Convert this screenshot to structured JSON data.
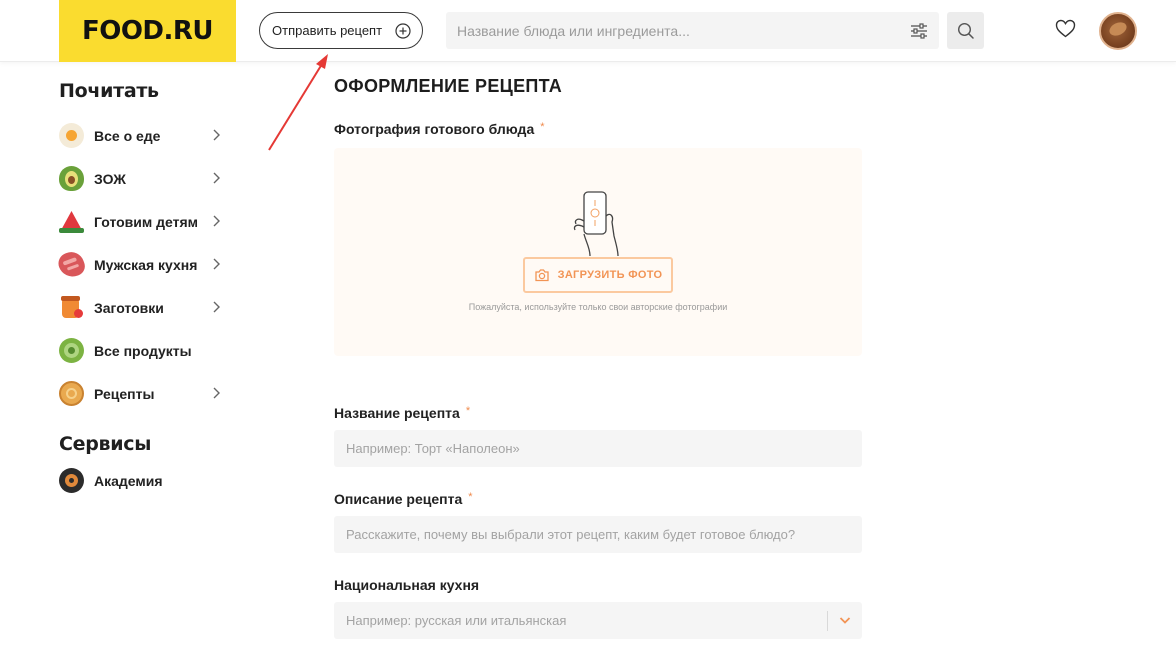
{
  "header": {
    "logo_text": "FOOD.RU",
    "send_recipe_label": "Отправить рецепт",
    "search_placeholder": "Название блюда или ингредиента..."
  },
  "sidebar": {
    "read_heading": "Почитать",
    "items": [
      {
        "label": "Все о еде",
        "icon": "egg-icon",
        "has_chevron": true
      },
      {
        "label": "ЗОЖ",
        "icon": "avocado-icon",
        "has_chevron": true
      },
      {
        "label": "Готовим детям",
        "icon": "watermelon-icon",
        "has_chevron": true
      },
      {
        "label": "Мужская кухня",
        "icon": "meat-icon",
        "has_chevron": true
      },
      {
        "label": "Заготовки",
        "icon": "jar-icon",
        "has_chevron": true
      },
      {
        "label": "Все продукты",
        "icon": "cabbage-icon",
        "has_chevron": false
      },
      {
        "label": "Рецепты",
        "icon": "pie-icon",
        "has_chevron": true
      }
    ],
    "services_heading": "Сервисы",
    "services": [
      {
        "label": "Академия",
        "icon": "academy-icon"
      }
    ]
  },
  "form": {
    "title": "ОФОРМЛЕНИЕ РЕЦЕПТА",
    "photo_label": "Фотография готового блюда",
    "upload_button": "ЗАГРУЗИТЬ ФОТО",
    "upload_hint": "Пожалуйста, используйте только свои авторские фотографии",
    "name_label": "Название рецепта",
    "name_placeholder": "Например: Торт «Наполеон»",
    "description_label": "Описание рецепта",
    "description_placeholder": "Расскажите, почему вы выбрали этот рецепт, каким будет готовое блюдо?",
    "cuisine_label": "Национальная кухня",
    "cuisine_placeholder": "Например: русская или итальянская",
    "required_mark": "*"
  },
  "colors": {
    "brand_yellow": "#fadc2f",
    "accent_orange": "#f29455",
    "annotation_red": "#e53935"
  }
}
